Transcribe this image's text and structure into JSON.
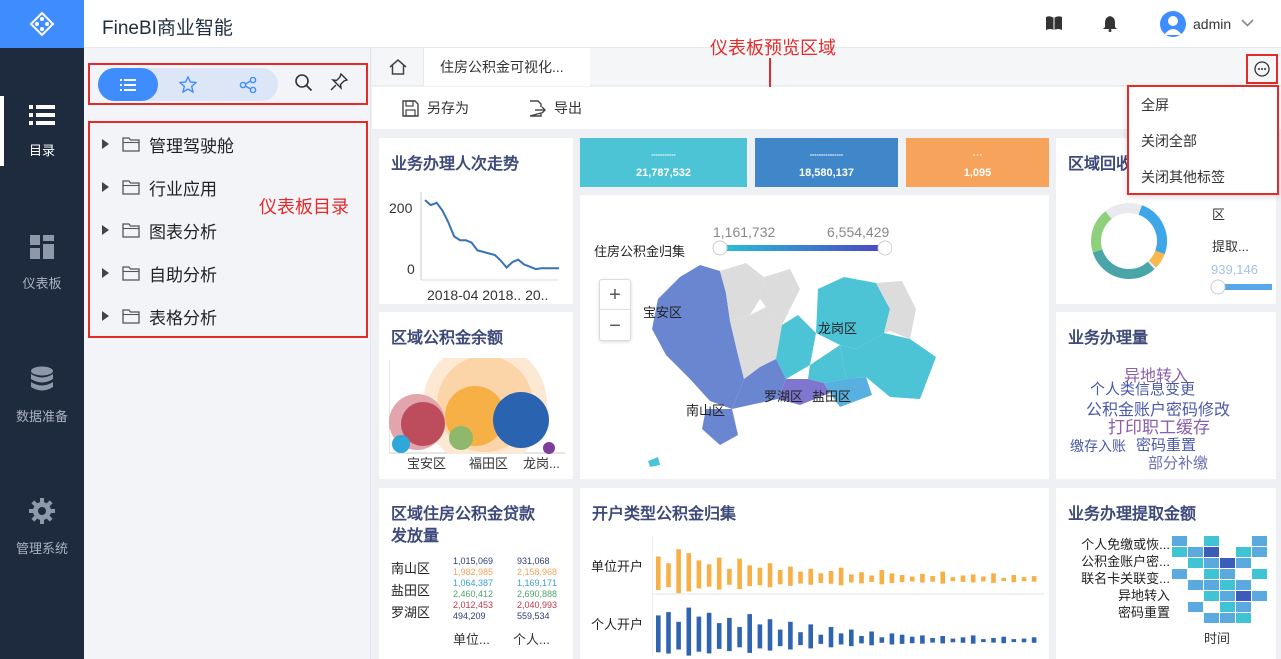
{
  "app": {
    "title": "FineBI商业智能",
    "username": "admin"
  },
  "nav": [
    {
      "label": "目录",
      "icon": "list-icon"
    },
    {
      "label": "仪表板",
      "icon": "dashboard-icon"
    },
    {
      "label": "数据准备",
      "icon": "database-icon"
    },
    {
      "label": "管理系统",
      "icon": "gear-icon"
    }
  ],
  "directory": {
    "items": [
      "管理驾驶舱",
      "行业应用",
      "图表分析",
      "自助分析",
      "表格分析"
    ],
    "annotation": "仪表板目录"
  },
  "preview": {
    "annotation": "仪表板预览区域",
    "tab_label": "住房公积金可视化...",
    "save_as": "另存为",
    "export": "导出"
  },
  "menu": [
    "全屏",
    "关闭全部",
    "关闭其他标签"
  ],
  "kpis": [
    {
      "label": "xxxxxxxxxxx",
      "value": "21,787,532",
      "color": "#4dc3d6"
    },
    {
      "label": "xxxxxxxxxxxxxxx",
      "value": "18,580,137",
      "color": "#3f87c9"
    },
    {
      "label": "x x x",
      "value": "1,095",
      "color": "#f7a35c"
    }
  ],
  "cards": {
    "trend": {
      "title": "业务办理人次走势",
      "ytick_top": "200",
      "ytick_bottom": "0",
      "xticks": "2018-04 2018.. 20.."
    },
    "balance": {
      "title": "区域公积金余额",
      "labels": [
        "宝安区",
        "福田区",
        "龙岗..."
      ]
    },
    "map": {
      "legend_title": "住房公积金归集",
      "range_min": "1,161,732",
      "range_max": "6,554,429",
      "zoom_in": "+",
      "zoom_out": "−",
      "districts": [
        "宝安区",
        "龙岗区",
        "南山区",
        "罗湖区",
        "盐田区"
      ]
    },
    "region_return": {
      "title": "区域回收",
      "legend_lines": [
        "区",
        "提取..."
      ],
      "range_value": "939,146"
    },
    "biz_volume": {
      "title": "业务办理量",
      "words": [
        "异地转入",
        "个人类信息变更",
        "公积金账户密码修改",
        "打印职工缓存",
        "缴存入账",
        "密码重置",
        "部分补缴"
      ]
    },
    "loans": {
      "title_line1": "区域住房公积金贷款",
      "title_line2": "发放量",
      "rows": [
        {
          "name": "南山区",
          "c1": [
            "1,015,069",
            "1,982,985"
          ],
          "c2": [
            "931,068",
            "2,158,968"
          ]
        },
        {
          "name": "盐田区",
          "c1": [
            "1,064,387",
            "2,460,412"
          ],
          "c2": [
            "1,169,171",
            "2,690,888"
          ]
        },
        {
          "name": "罗湖区",
          "c1": [
            "2,012,453",
            "494,209"
          ],
          "c2": [
            "2,040,993",
            "559,534"
          ]
        }
      ],
      "footer": [
        "单位...",
        "个人..."
      ]
    },
    "account_type": {
      "title": "开户类型公积金归集",
      "rows": [
        "单位开户",
        "个人开户"
      ]
    },
    "withdraw": {
      "title": "业务办理提取金额",
      "rows": [
        "个人免缴或恢...",
        "公积金账户密...",
        "联名卡关联变...",
        "异地转入",
        "密码重置"
      ],
      "axis": "时间"
    }
  },
  "chart_data": [
    {
      "type": "line",
      "title": "业务办理人次走势",
      "x": [
        "2018-04",
        "2018..",
        "20.."
      ],
      "ylim": [
        0,
        200
      ],
      "series": [
        {
          "values": [
            205,
            192,
            198,
            178,
            148,
            112,
            102,
            102,
            96,
            76,
            72,
            68,
            64,
            50,
            32,
            46,
            52,
            40,
            34,
            28,
            30,
            30,
            30,
            30
          ]
        }
      ]
    },
    {
      "type": "scatter",
      "title": "区域公积金余额",
      "categories": [
        "宝安区",
        "福田区",
        "龙岗..."
      ]
    },
    {
      "type": "bar",
      "title": "开户类型公积金归集",
      "series": [
        {
          "name": "单位开户",
          "values": [
            42,
            30,
            55,
            48,
            35,
            28,
            40,
            20,
            38,
            26,
            22,
            30,
            18,
            24,
            15,
            20,
            12,
            16,
            22,
            10,
            14,
            8,
            18,
            12,
            9,
            6,
            11,
            7,
            15,
            5,
            8,
            10,
            6,
            12,
            4,
            9,
            5,
            7
          ]
        },
        {
          "name": "个人开户",
          "values": [
            40,
            45,
            30,
            52,
            38,
            44,
            28,
            36,
            22,
            42,
            26,
            34,
            18,
            30,
            14,
            26,
            10,
            22,
            12,
            18,
            8,
            15,
            6,
            12,
            10,
            7,
            9,
            5,
            8,
            4,
            6,
            9,
            3,
            5,
            7,
            2,
            4,
            6
          ]
        }
      ]
    }
  ]
}
